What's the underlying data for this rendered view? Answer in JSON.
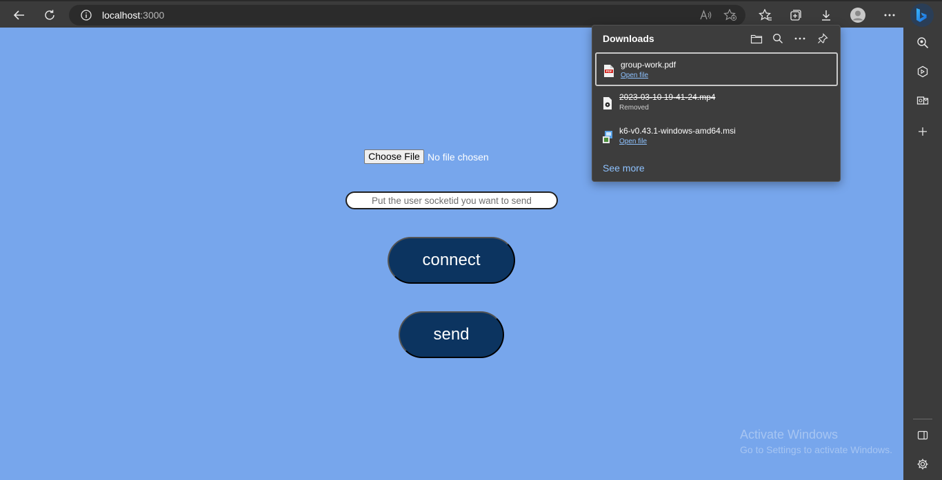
{
  "browser": {
    "url_host": "localhost",
    "url_port": ":3000",
    "accent_color": "#0c3460",
    "page_background": "#77a6ec",
    "toolbar_icons": [
      "back-icon",
      "refresh-icon",
      "info-icon",
      "read-aloud-icon",
      "add-favorite-icon",
      "favorites-icon",
      "collections-icon",
      "downloads-icon",
      "profile-icon",
      "more-icon",
      "bing-icon"
    ],
    "sidebar_icons": [
      "search-icon",
      "shopping-icon",
      "outlook-icon",
      "add-icon",
      "hide-sidebar-icon",
      "settings-icon"
    ]
  },
  "page": {
    "choose_file_label": "Choose File",
    "no_file_text": "No file chosen",
    "socket_placeholder": "Put the user socketid you want to send",
    "connect_label": "connect",
    "send_label": "send"
  },
  "downloads": {
    "title": "Downloads",
    "items": [
      {
        "name": "group-work.pdf",
        "link": "Open file",
        "icon": "pdf-file-icon"
      },
      {
        "name": "2023-03-10 19-41-24.mp4",
        "status": "Removed",
        "icon": "video-file-icon"
      },
      {
        "name": "k6-v0.43.1-windows-amd64.msi",
        "link": "Open file",
        "icon": "installer-file-icon"
      }
    ],
    "see_more": "See more"
  },
  "watermark": {
    "line1": "Activate Windows",
    "line2": "Go to Settings to activate Windows."
  }
}
